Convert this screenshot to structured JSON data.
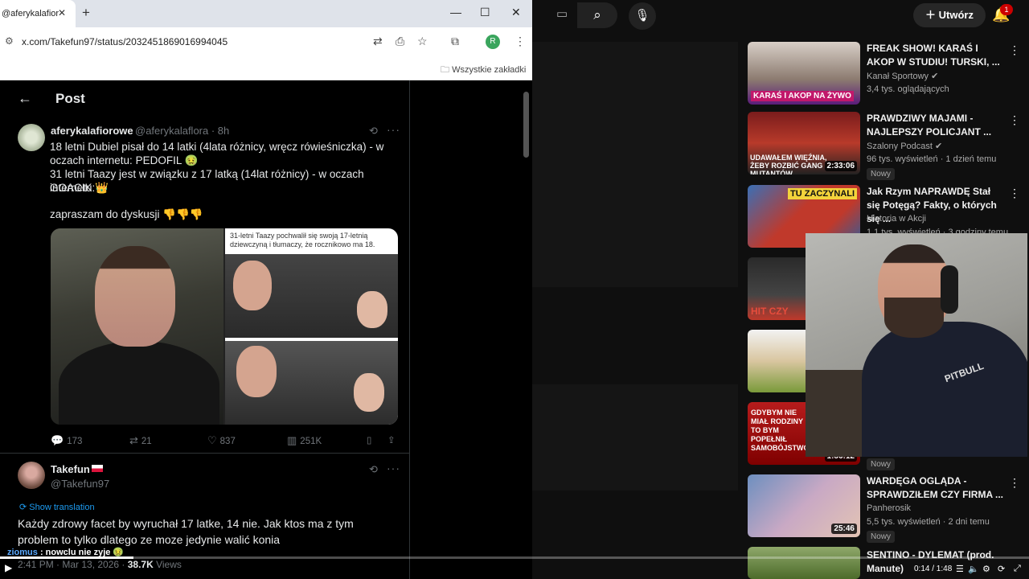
{
  "browser": {
    "tab_title": "@aferykalafior",
    "url": "x.com/Takefun97/status/2032451869016994045",
    "bookmarks_label": "Wszystkie zakładki",
    "profile_initial": "R"
  },
  "x_post": {
    "header": "Post",
    "author_name": "aferykalafiorowe",
    "author_handle": "@aferykalaflora · 8h",
    "text_lines": [
      "18 letni Dubiel pisał do 14 latki (4lata różnicy, wręcz rówieśniczka) - w",
      "oczach internetu: PEDOFIL 🤢",
      "31 letni Taazy jest w związku z 17 latką (14lat różnicy) - w oczach internetu:",
      "GOACIK 👑",
      "zapraszam do dyskusji 👎👎👎"
    ],
    "media_caption": "31-letni Taazy pochwalił się swoją 17-letnią dziewczyną i tłumaczy, że rocznikowo ma 18.",
    "stats": {
      "replies": "173",
      "reposts": "21",
      "likes": "837",
      "views": "251K"
    },
    "reply_author_name": "Takefun",
    "reply_author_handle": "@Takefun97",
    "show_translation": "Show translation",
    "reply_text": "Każdy zdrowy facet by wyruchał 17 latke, 14 nie. Jak ktos ma z tym problem to tylko dlatego ze moze jedynie walić konia",
    "reply_time": "2:41 PM · Mar 13, 2026 · ",
    "reply_views": "38.7K",
    "reply_views_label": " Views"
  },
  "youtube": {
    "create_label": "Utwórz",
    "notification_count": "1",
    "recommendations": [
      {
        "title": "FREAK SHOW! KARAŚ I AKOP W STUDIU! TURSKI, ...",
        "channel": "Kanał Sportowy ✔",
        "meta": "3,4 tys. oglądających",
        "thumb_text": "KARAŚ I AKOP NA ŻYWO",
        "duration": "",
        "badge": ""
      },
      {
        "title": "PRAWDZIWY MAJAMI - NAJLEPSZY POLICJANT ...",
        "channel": "Szalony Podcast ✔",
        "meta": "96 tys. wyświetleń · 1 dzień temu",
        "thumb_text": "UDAWAŁEM WIĘŹNIA, ŻEBY ROZBIĆ GANG MUTANTÓW",
        "duration": "2:33:06",
        "badge": "Nowy"
      },
      {
        "title": "Jak Rzym NAPRAWDĘ Stał się Potęgą? Fakty, o których się ...",
        "channel": "Historia w Akcji",
        "meta": "1,1 tys. wyświetleń · 3 godziny temu",
        "thumb_text": "TU ZACZYNALI",
        "duration": "",
        "badge": ""
      },
      {
        "title": "",
        "channel": "",
        "meta": "",
        "thumb_text": "HIT CZY",
        "duration": "",
        "badge": ""
      },
      {
        "title": "",
        "channel": "",
        "meta": "",
        "thumb_text": "",
        "duration": "",
        "badge": ""
      },
      {
        "title": "",
        "channel": "",
        "meta": "",
        "thumb_text": "GDYBYM NIE MIAŁ RODZINY TO BYM POPEŁNIŁ SAMOBÓJSTWO",
        "duration": "1:56:12",
        "badge": "Nowy"
      },
      {
        "title": "WARDĘGA OGLĄDA - SPRAWDZIŁEM CZY FIRMA ...",
        "channel": "Panherosik",
        "meta": "5,5 tys. wyświetleń · 2 dni temu",
        "thumb_text": "",
        "duration": "25:46",
        "badge": "Nowy"
      },
      {
        "title": "SENTINO - DYLEMAT (prod. Manute)",
        "channel": "",
        "meta": "",
        "thumb_text": "",
        "duration": "",
        "badge": ""
      }
    ]
  },
  "webcam": {
    "shirt_logo": "PITBULL"
  },
  "player": {
    "chat_user": "ziomus",
    "chat_message": " : nowclu nie zyje 🤢",
    "time": "0:14 / 1:48",
    "progress": 0.13
  },
  "colors": {
    "x_blue": "#1d9bf0",
    "yt_red": "#cc0000",
    "green_avatar": "#3aa55d"
  }
}
